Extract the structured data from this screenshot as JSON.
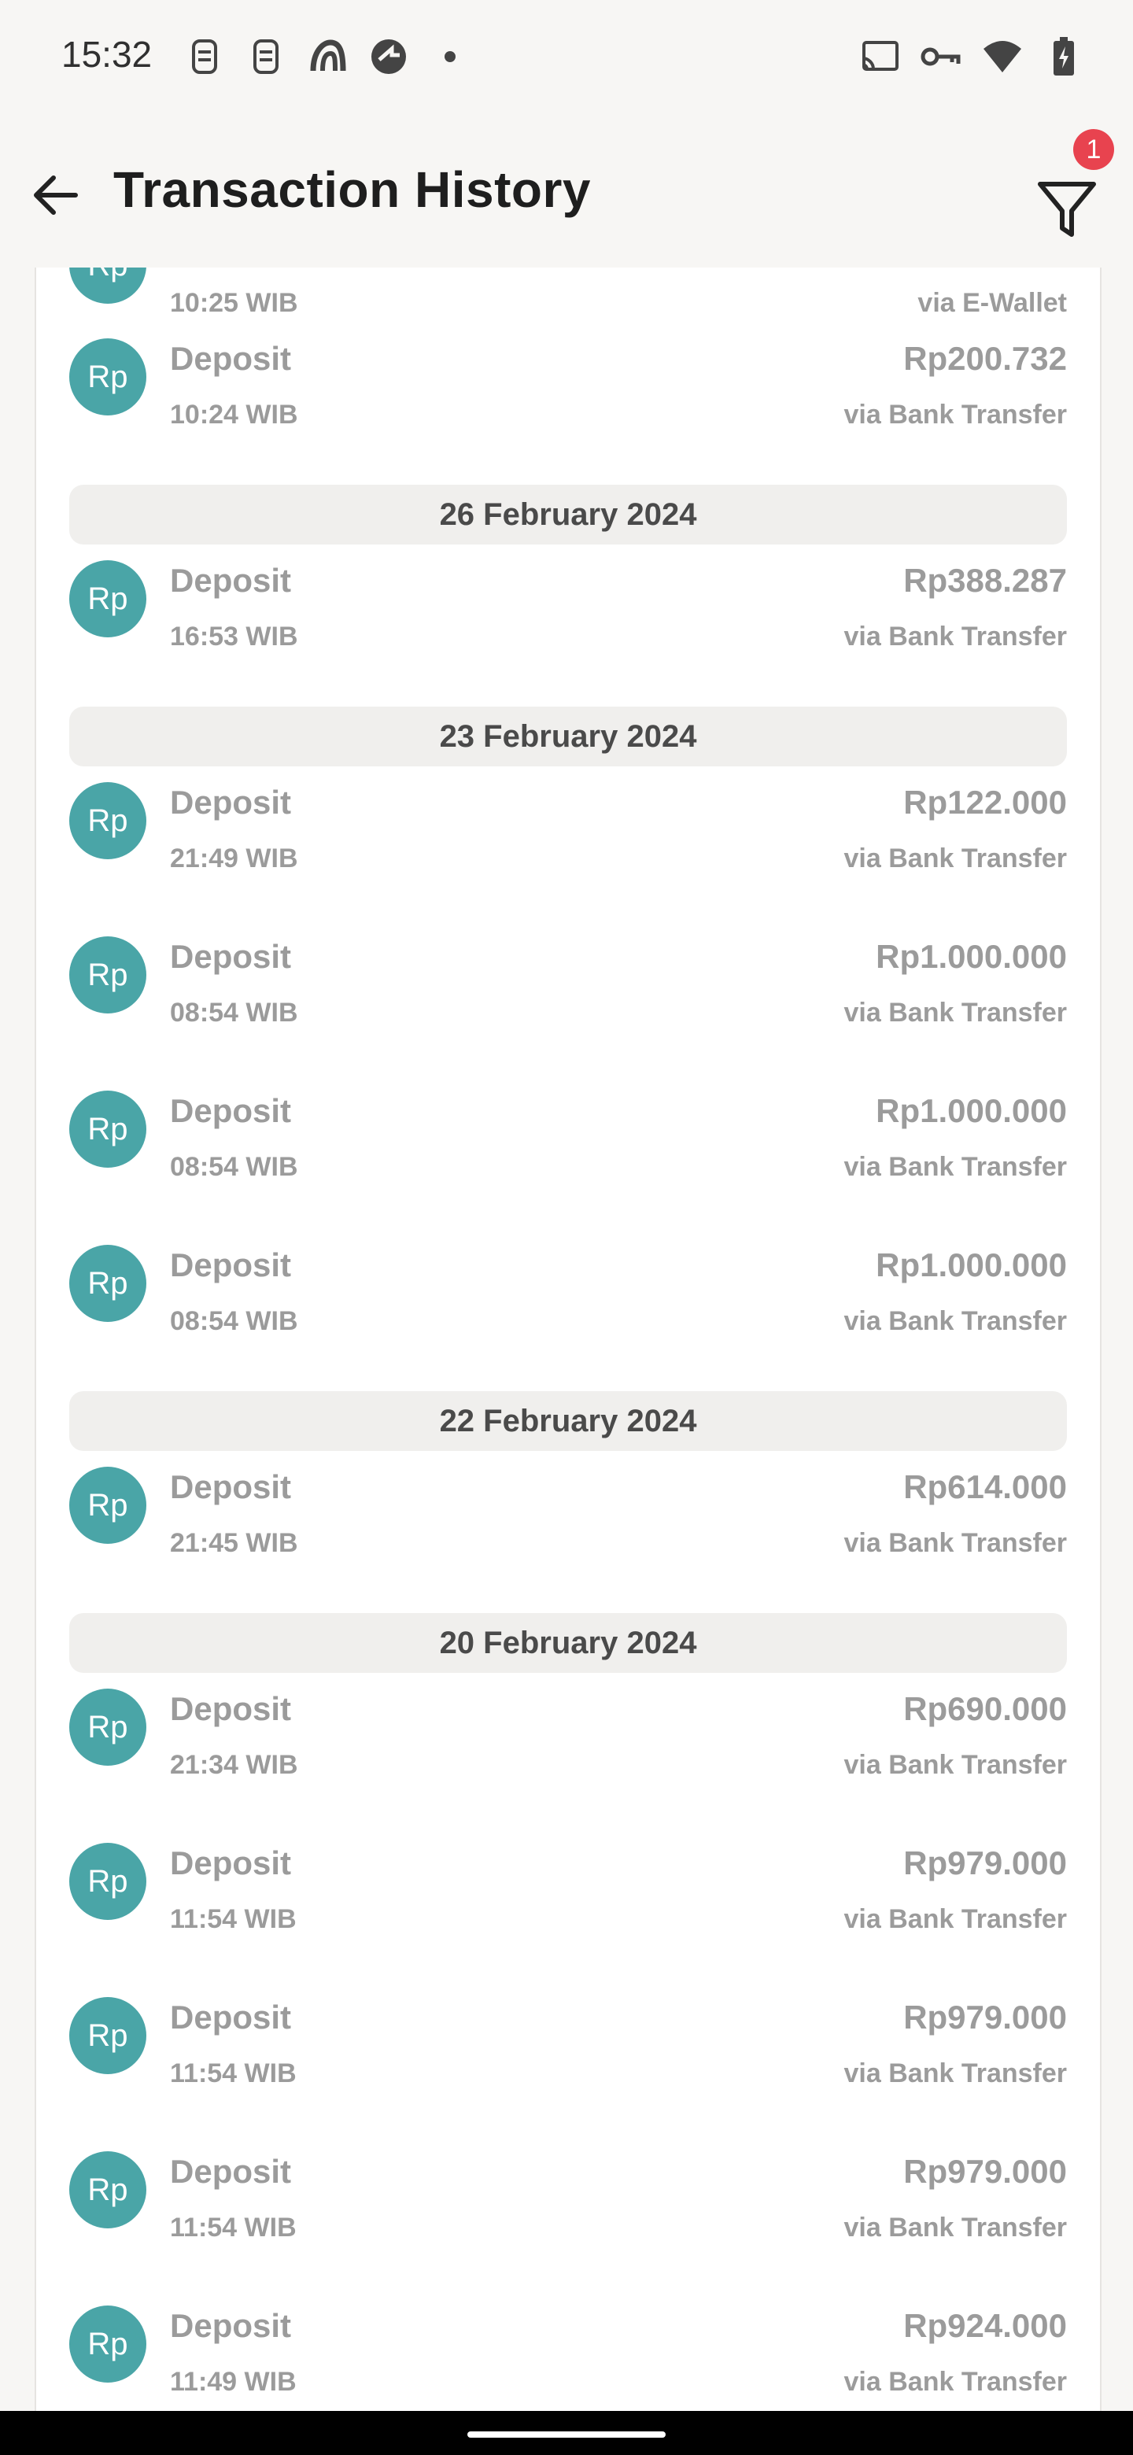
{
  "status_bar": {
    "time": "15:32",
    "left_icons": [
      "sim-icon",
      "sim-icon",
      "app-icon",
      "app-icon",
      "dot-icon"
    ],
    "right_icons": [
      "cast-icon",
      "vpn-key-icon",
      "wifi-icon",
      "battery-icon"
    ]
  },
  "header": {
    "title": "Transaction History",
    "filter_badge": "1"
  },
  "avatar_label": "Rp",
  "partial_top": {
    "time": "10:25 WIB",
    "method": "via E-Wallet"
  },
  "groups": [
    {
      "date": "",
      "items": [
        {
          "type": "Deposit",
          "time": "10:24 WIB",
          "amount": "Rp200.732",
          "method": "via Bank Transfer"
        }
      ]
    },
    {
      "date": "26 February 2024",
      "items": [
        {
          "type": "Deposit",
          "time": "16:53 WIB",
          "amount": "Rp388.287",
          "method": "via Bank Transfer"
        }
      ]
    },
    {
      "date": "23 February 2024",
      "items": [
        {
          "type": "Deposit",
          "time": "21:49 WIB",
          "amount": "Rp122.000",
          "method": "via Bank Transfer"
        },
        {
          "type": "Deposit",
          "time": "08:54 WIB",
          "amount": "Rp1.000.000",
          "method": "via Bank Transfer"
        },
        {
          "type": "Deposit",
          "time": "08:54 WIB",
          "amount": "Rp1.000.000",
          "method": "via Bank Transfer"
        },
        {
          "type": "Deposit",
          "time": "08:54 WIB",
          "amount": "Rp1.000.000",
          "method": "via Bank Transfer"
        }
      ]
    },
    {
      "date": "22 February 2024",
      "items": [
        {
          "type": "Deposit",
          "time": "21:45 WIB",
          "amount": "Rp614.000",
          "method": "via Bank Transfer"
        }
      ]
    },
    {
      "date": "20 February 2024",
      "items": [
        {
          "type": "Deposit",
          "time": "21:34 WIB",
          "amount": "Rp690.000",
          "method": "via Bank Transfer"
        },
        {
          "type": "Deposit",
          "time": "11:54 WIB",
          "amount": "Rp979.000",
          "method": "via Bank Transfer"
        },
        {
          "type": "Deposit",
          "time": "11:54 WIB",
          "amount": "Rp979.000",
          "method": "via Bank Transfer"
        },
        {
          "type": "Deposit",
          "time": "11:54 WIB",
          "amount": "Rp979.000",
          "method": "via Bank Transfer"
        },
        {
          "type": "Deposit",
          "time": "11:49 WIB",
          "amount": "Rp924.000",
          "method": "via Bank Transfer"
        }
      ]
    }
  ],
  "colors": {
    "avatar": "#4aa5a7",
    "badge": "#e8434f",
    "muted_text": "#9b9b9b",
    "date_header_bg": "#f0efed"
  }
}
